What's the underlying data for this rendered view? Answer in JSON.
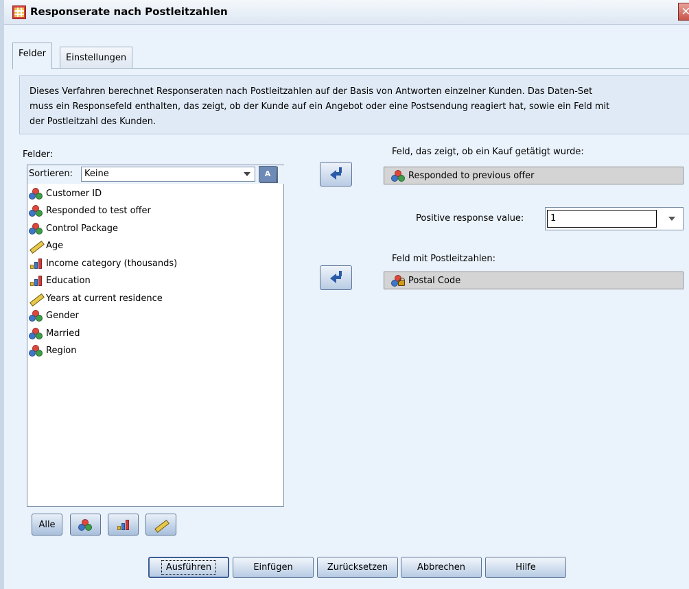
{
  "window": {
    "title": "Responserate nach Postleitzahlen",
    "close_glyph": "✕"
  },
  "tabs": [
    {
      "label": "Felder",
      "active": true
    },
    {
      "label": "Einstellungen",
      "active": false
    }
  ],
  "description": {
    "line1": "Dieses Verfahren berechnet Responseraten nach Postleitzahlen auf der Basis von Antworten einzelner Kunden. Das Daten-Set",
    "line2": "muss ein Responsefeld enthalten, das zeigt, ob der Kunde auf ein Angebot oder eine Postsendung reagiert hat, sowie ein Feld mit",
    "line3": "der Postleitzahl des Kunden."
  },
  "fields_panel": {
    "label": "Felder:",
    "sort_label": "Sortieren:",
    "sort_value": "Keine",
    "alpha_sort_glyph": "A",
    "items": [
      {
        "label": "Customer ID",
        "icon": "nominal-icon"
      },
      {
        "label": "Responded to test offer",
        "icon": "nominal-icon"
      },
      {
        "label": "Control Package",
        "icon": "nominal-icon"
      },
      {
        "label": "Age",
        "icon": "scale-icon"
      },
      {
        "label": "Income category (thousands)",
        "icon": "ordinal-icon"
      },
      {
        "label": "Education",
        "icon": "ordinal-icon"
      },
      {
        "label": "Years at current residence",
        "icon": "scale-icon"
      },
      {
        "label": "Gender",
        "icon": "nominal-icon"
      },
      {
        "label": "Married",
        "icon": "nominal-icon"
      },
      {
        "label": "Region",
        "icon": "nominal-icon"
      }
    ],
    "filter_buttons": {
      "all_label": "Alle"
    }
  },
  "purchase_field": {
    "label": "Feld, das zeigt, ob ein Kauf getätigt wurde:",
    "value": "Responded to previous offer"
  },
  "positive_response": {
    "label": "Positive response value:",
    "value": "1"
  },
  "postal_field": {
    "label": "Feld mit Postleitzahlen:",
    "value": "Postal Code"
  },
  "footer": {
    "run": "Ausführen",
    "paste": "Einfügen",
    "reset": "Zurücksetzen",
    "cancel": "Abbrechen",
    "help": "Hilfe"
  }
}
